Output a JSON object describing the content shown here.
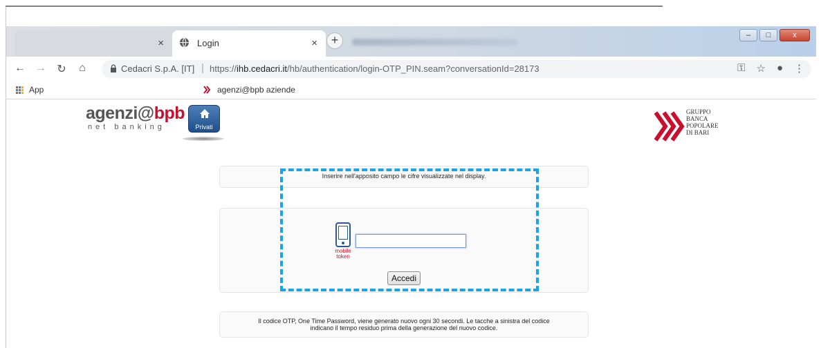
{
  "browser": {
    "tabs": [
      {
        "title": "",
        "active": false
      },
      {
        "title": "Login",
        "active": true
      }
    ],
    "new_tab_symbol": "+",
    "close_symbol": "×",
    "window_controls": {
      "minimize": "–",
      "maximize": "□",
      "close": "x"
    },
    "address": {
      "site_name": "Cedacri S.p.A. [IT]",
      "separator": "|",
      "url_prefix": "https://",
      "url_domain": "ihb.cedacri.it",
      "url_path": "/hb/authentication/login-OTP_PIN.seam?conversationId=28173"
    },
    "bookmarks": [
      {
        "label": "App",
        "icon": "apps-grid-icon"
      },
      {
        "label": "agenzi@bpb aziende",
        "icon": "bpb-logo-icon"
      }
    ]
  },
  "page": {
    "logo": {
      "part1": "agenzi@",
      "part2": "bpb",
      "sub": "net banking",
      "badge": "Privati"
    },
    "gruppo": [
      "GRUPPO",
      "BANCA",
      "POPOLARE",
      "DI BARI"
    ],
    "instruction": "Inserire nell'apposito campo le cifre visualizzate nel display.",
    "token_label": [
      "mobile",
      "token"
    ],
    "otp_value": "",
    "submit_label": "Accedi",
    "info_text_line1": "Il codice OTP, One Time Password, viene generato nuovo ogni 30 secondi. Le tacche a sinistra del codice",
    "info_text_line2": "indicano il tempo residuo prima della generazione del nuovo codice."
  },
  "colors": {
    "highlight": "#1ca3e3",
    "brand_red": "#c8102e",
    "privati_blue": "#1f4f8c"
  }
}
